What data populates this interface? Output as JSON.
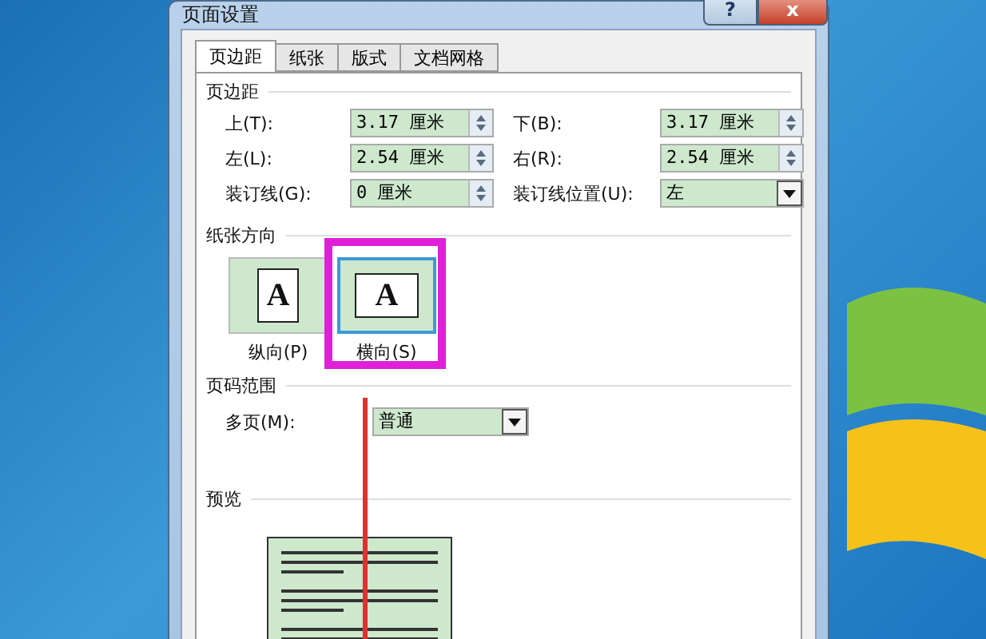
{
  "window": {
    "title": "页面设置",
    "help_button": "?",
    "close_button": "x"
  },
  "tabs": [
    {
      "label": "页边距",
      "selected": true
    },
    {
      "label": "纸张",
      "selected": false
    },
    {
      "label": "版式",
      "selected": false
    },
    {
      "label": "文档网格",
      "selected": false
    }
  ],
  "margins": {
    "heading": "页边距",
    "fields": [
      {
        "label": "上(T):",
        "value": "3.17 厘米",
        "kind": "spin"
      },
      {
        "label": "下(B):",
        "value": "3.17 厘米",
        "kind": "spin"
      },
      {
        "label": "左(L):",
        "value": "2.54 厘米",
        "kind": "spin"
      },
      {
        "label": "右(R):",
        "value": "2.54 厘米",
        "kind": "spin"
      },
      {
        "label": "装订线(G):",
        "value": "0 厘米",
        "kind": "spin"
      },
      {
        "label": "装订线位置(U):",
        "value": "左",
        "kind": "dropdown"
      }
    ]
  },
  "orientation": {
    "heading": "纸张方向",
    "options": [
      {
        "label": "纵向(P)",
        "glyph": "A",
        "kind": "portrait",
        "selected": false,
        "highlighted": false
      },
      {
        "label": "横向(S)",
        "glyph": "A",
        "kind": "landscape",
        "selected": true,
        "highlighted": true
      }
    ]
  },
  "pages": {
    "heading": "页码范围",
    "label": "多页(M):",
    "value": "普通"
  },
  "preview": {
    "heading": "预览"
  }
}
